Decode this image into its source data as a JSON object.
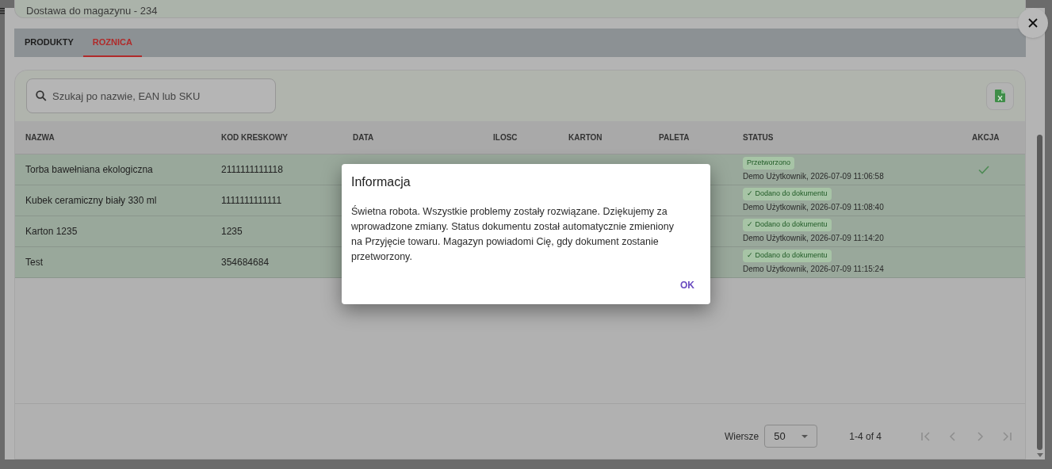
{
  "header": {
    "title": "Dostawa do magazynu - 234"
  },
  "tabs": [
    {
      "label": "PRODUKTY",
      "selected": false
    },
    {
      "label": "ROZNICA",
      "selected": true
    }
  ],
  "search": {
    "placeholder": "Szukaj po nazwie, EAN lub SKU"
  },
  "table": {
    "columns": [
      "NAZWA",
      "KOD KRESKOWY",
      "DATA",
      "ILOSC",
      "KARTON",
      "PALETA",
      "STATUS",
      "AKCJA"
    ],
    "rows": [
      {
        "name": "Torba bawełniana ekologiczna",
        "barcode": "2111111111118",
        "status": "Przetworzono",
        "status_detail": "Demo Użytkownik, 2026-07-09 11:06:58",
        "action_done": true
      },
      {
        "name": "Kubek ceramiczny biały 330 ml",
        "barcode": "1111111111111",
        "status": "✓ Dodano do dokumentu",
        "status_detail": "Demo Użytkownik, 2026-07-09 11:08:40",
        "action_done": false
      },
      {
        "name": "Karton 1235",
        "barcode": "1235",
        "status": "✓ Dodano do dokumentu",
        "status_detail": "Demo Użytkownik, 2026-07-09 11:14:20",
        "action_done": false
      },
      {
        "name": "Test",
        "barcode": "354684684",
        "status": "✓ Dodano do dokumentu",
        "status_detail": "Demo Użytkownik, 2026-07-09 11:15:24",
        "action_done": false
      }
    ]
  },
  "pagination": {
    "rows_label": "Wiersze",
    "rows_per_page": "50",
    "range": "1-4 of 4",
    "buttons": [
      {
        "kind": "first",
        "disabled": true
      },
      {
        "kind": "prev",
        "disabled": true
      },
      {
        "kind": "next",
        "disabled": true
      },
      {
        "kind": "last",
        "disabled": true
      }
    ]
  },
  "dialog": {
    "title": "Informacja",
    "message": "Świetna robota. Wszystkie problemy zostały rozwiązane. Dziękujemy za wprowadzone zmiany. Status dokumentu został automatycznie zmieniony na Przyjęcie towaru. Magazyn powiadomi Cię, gdy dokument zostanie przetworzony.",
    "button": "OK"
  }
}
